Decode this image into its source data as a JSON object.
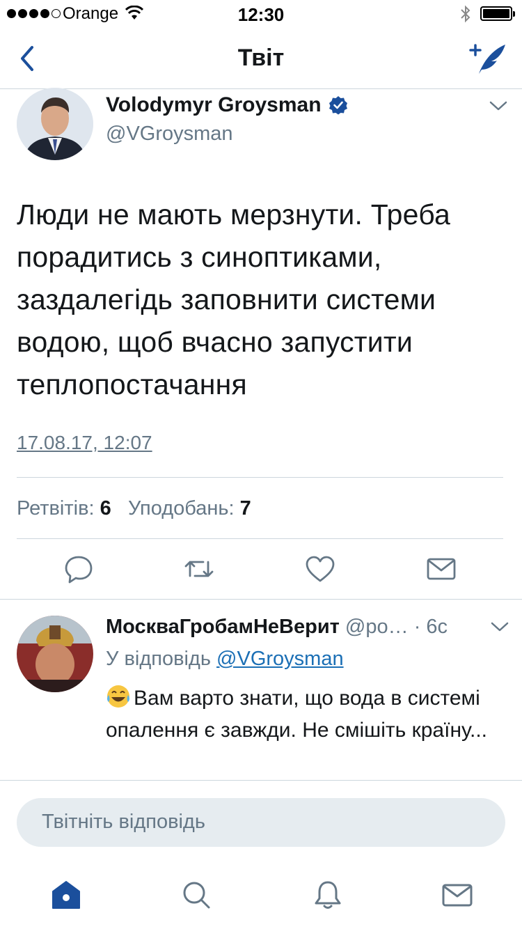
{
  "status_bar": {
    "carrier": "Orange",
    "time": "12:30"
  },
  "nav": {
    "title": "Твіт",
    "back_icon": "chevron-left-icon",
    "compose_icon": "compose-tweet-icon"
  },
  "colors": {
    "accent": "#1b4f9c",
    "link": "#1b6fb5",
    "muted": "#657786",
    "divider": "#ccd6dd",
    "field": "#e6ecf0"
  },
  "tweet": {
    "author": "Volodymyr Groysman",
    "handle": "@VGroysman",
    "verified": true,
    "text": "Люди не мають мерзнути. Треба порадитись з синоптиками, заздалегідь заповнити системи водою, щоб вчасно запустити теплопостачання",
    "timestamp": "17.08.17, 12:07",
    "retweets_label": "Ретвітів:",
    "retweets_count": "6",
    "likes_label": "Уподобань:",
    "likes_count": "7",
    "actions": [
      "reply-icon",
      "retweet-icon",
      "like-icon",
      "message-icon"
    ]
  },
  "reply": {
    "author": "МоскваГробамНеВерит",
    "handle": "@ро…",
    "time": "· 6с",
    "in_reply_prefix": "У відповідь",
    "in_reply_handle": "@VGroysman",
    "emoji": "😂",
    "text": "Вам варто знати, що вода в системі опалення є завжди. Не смішіть країну..."
  },
  "reply_field": {
    "placeholder": "Твітніть відповідь"
  },
  "tab_bar": [
    "home-icon",
    "search-icon",
    "notifications-icon",
    "messages-icon"
  ]
}
